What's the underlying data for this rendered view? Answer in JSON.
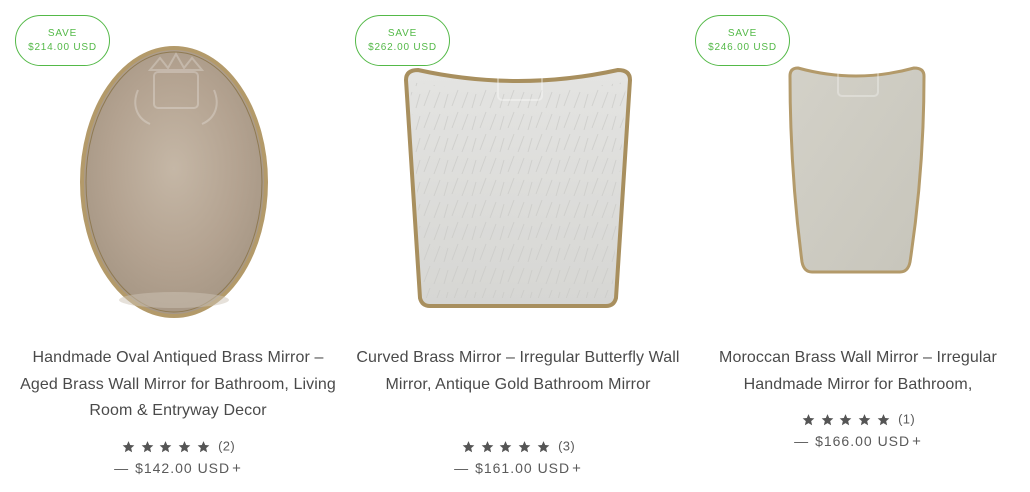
{
  "products": [
    {
      "badge_line1": "SAVE",
      "badge_line2": "$214.00 USD",
      "title": "Handmade Oval Antiqued Brass Mirror – Aged Brass Wall Mirror for Bathroom, Living Room & Entryway Decor",
      "rating_value": 5,
      "rating_count": "(2)",
      "price_dash": "—",
      "price": "$142.00 USD",
      "price_plus": "+"
    },
    {
      "badge_line1": "SAVE",
      "badge_line2": "$262.00 USD",
      "title": "Curved Brass Mirror – Irregular Butterfly Wall Mirror, Antique Gold Bathroom Mirror",
      "rating_value": 5,
      "rating_count": "(3)",
      "price_dash": "—",
      "price": "$161.00 USD",
      "price_plus": "+"
    },
    {
      "badge_line1": "SAVE",
      "badge_line2": "$246.00 USD",
      "title": "Moroccan Brass Wall Mirror – Irregular Handmade Mirror for Bathroom,",
      "rating_value": 5,
      "rating_count": "(1)",
      "price_dash": "—",
      "price": "$166.00 USD",
      "price_plus": "+"
    }
  ],
  "icons": {
    "star": "star-icon",
    "watermark": "crest-watermark-icon"
  },
  "colors": {
    "badge_green": "#54b948",
    "text": "#4a4a4a",
    "star": "#555555",
    "brass_frame": "#b39a6a"
  }
}
